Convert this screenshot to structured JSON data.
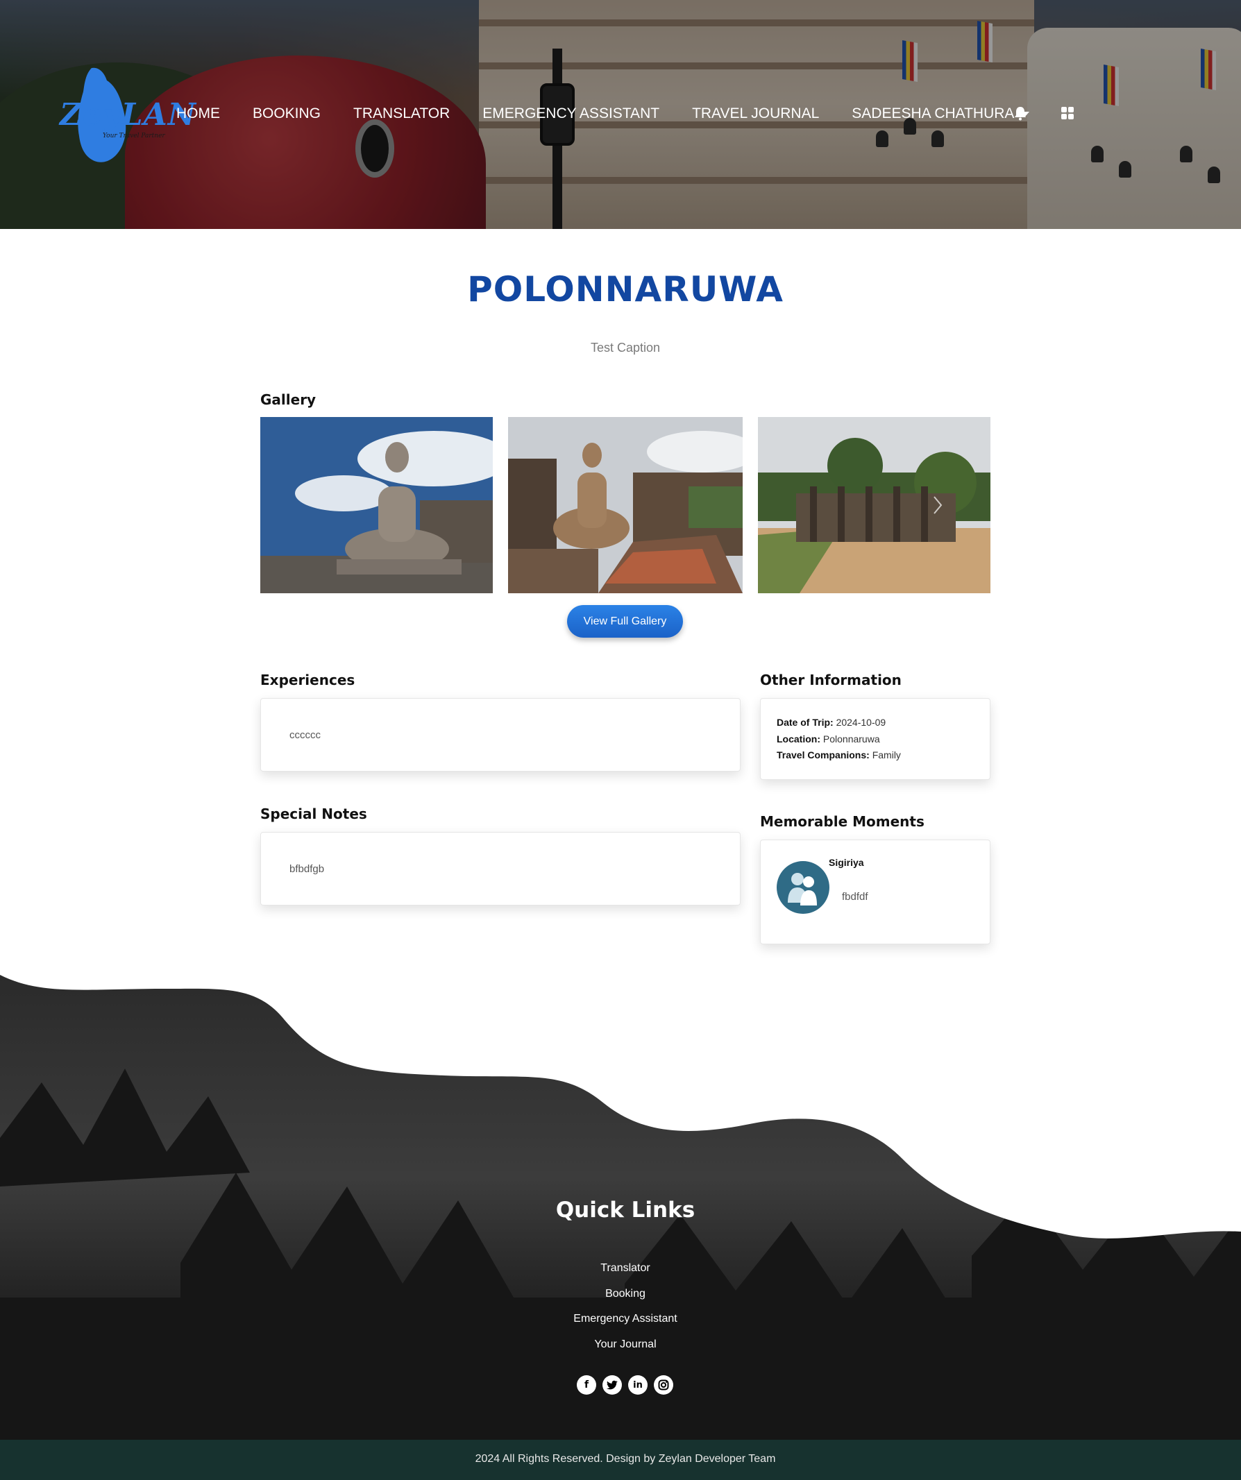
{
  "nav": {
    "logo_text": "ZeyLAN",
    "logo_tagline": "Your Travel Partner",
    "links": [
      "HOME",
      "BOOKING",
      "TRANSLATOR",
      "EMERGENCY ASSISTANT",
      "TRAVEL JOURNAL",
      "SADEESHA CHATHURA"
    ],
    "icons": [
      "bell-icon",
      "grid-menu-icon"
    ]
  },
  "journal": {
    "title": "POLONNARUWA",
    "caption": "Test Caption"
  },
  "gallery": {
    "heading": "Gallery",
    "images": [
      "buddha-statue-photo",
      "seated-buddha-ruins-photo",
      "pillared-ruins-photo"
    ],
    "button_label": "View Full Gallery"
  },
  "experiences": {
    "heading": "Experiences",
    "text": "cccccc"
  },
  "special_notes": {
    "heading": "Special Notes",
    "text": "bfbdfgb"
  },
  "other_information": {
    "heading": "Other Information",
    "date_label": "Date of Trip:",
    "date_value": "2024-10-09",
    "location_label": "Location:",
    "location_value": "Polonnaruwa",
    "companions_label": "Travel Companions:",
    "companions_value": "Family"
  },
  "memorable_moments": {
    "heading": "Memorable Moments",
    "items": [
      {
        "title": "Sigiriya",
        "text": "fbdfdf",
        "icon": "user-group-icon"
      }
    ]
  },
  "footer": {
    "quick_links_title": "Quick Links",
    "links": [
      "Translator",
      "Booking",
      "Emergency Assistant",
      "Your Journal"
    ],
    "social_icons": [
      "facebook-icon",
      "twitter-icon",
      "linkedin-icon",
      "instagram-icon"
    ],
    "copyright": "2024 All Rights Reserved. Design by Zeylan Developer Team"
  },
  "colors": {
    "title_blue": "#1247a1",
    "button_blue": "#1f6fd6",
    "footer_bar": "#17322f"
  }
}
